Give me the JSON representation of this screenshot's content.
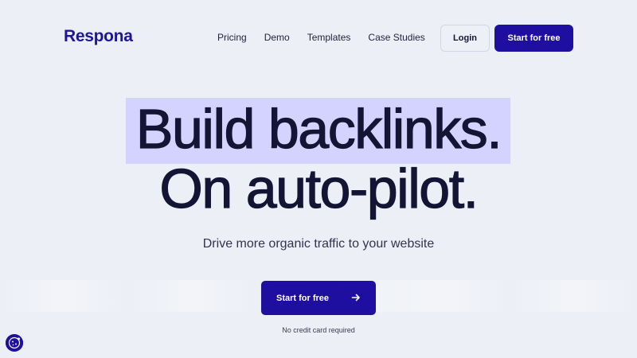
{
  "brand": {
    "name": "Respona",
    "color": "#1e1699"
  },
  "nav": {
    "items": [
      "Pricing",
      "Demo",
      "Templates",
      "Case Studies"
    ]
  },
  "header": {
    "login_label": "Login",
    "start_label": "Start for free"
  },
  "hero": {
    "headline_line1": "Build backlinks.",
    "headline_line2": "On auto-pilot.",
    "subtitle": "Drive more organic traffic to your website",
    "cta_label": "Start for free",
    "note": "No credit card required"
  },
  "colors": {
    "accent": "#1e0fa0",
    "highlight": "#d4d3ff",
    "background": "#eceff6",
    "text": "#141434"
  },
  "icons": {
    "cta_icon": "arrow-right-icon",
    "cookie_icon": "cookie-icon"
  }
}
